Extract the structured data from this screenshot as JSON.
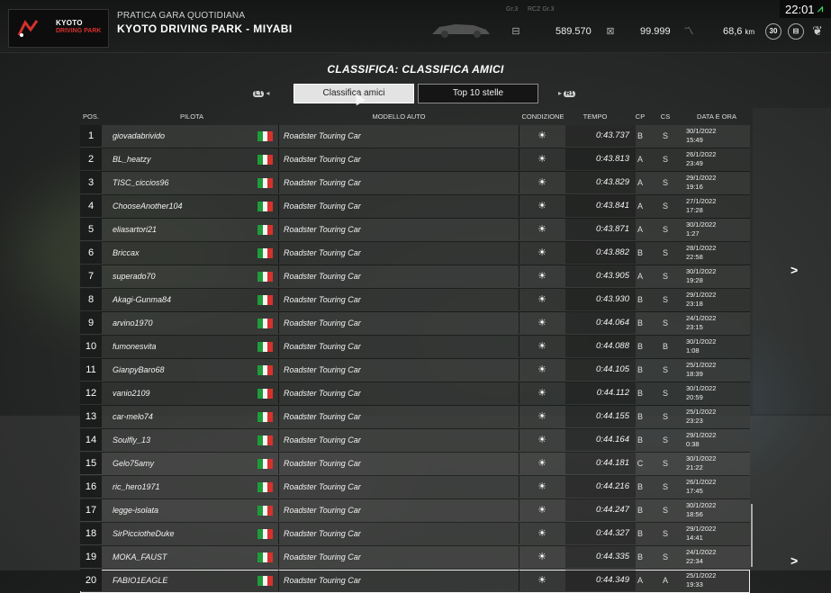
{
  "header": {
    "logo": {
      "line1": "KYOTO",
      "line2": "DRIVING PARK"
    },
    "event_subtitle": "PRATICA GARA QUOTIDIANA",
    "event_title": "KYOTO DRIVING PARK - MIYABI",
    "tags": [
      "Gr.3",
      "RCZ Gr.3"
    ],
    "stats": [
      {
        "icon": "credits-icon",
        "value": "589.570"
      },
      {
        "icon": "mileage-icon",
        "value": "99.999"
      },
      {
        "icon": "distance-icon",
        "value": "68,6",
        "unit": "km"
      }
    ],
    "level_badge": "30",
    "clock": "22:01"
  },
  "page_title": "CLASSIFICA: CLASSIFICA AMICI",
  "tabs": {
    "left_hint": "L1",
    "right_hint": "R1",
    "items": [
      {
        "label": "Classifica amici",
        "active": true
      },
      {
        "label": "Top 10 stelle",
        "active": false
      }
    ]
  },
  "columns": {
    "pos": "POS.",
    "driver": "PILOTA",
    "car": "MODELLO AUTO",
    "condition": "CONDIZIONE",
    "time": "TEMPO",
    "cp": "CP",
    "cs": "CS",
    "date": "DATA E ORA"
  },
  "rows": [
    {
      "pos": "1",
      "name": "giovadabrivido",
      "car": "Roadster Touring Car",
      "time": "0:43.737",
      "cp": "B",
      "cs": "S",
      "date": "30/1/2022",
      "hour": "15:49"
    },
    {
      "pos": "2",
      "name": "BL_heatzy",
      "car": "Roadster Touring Car",
      "time": "0:43.813",
      "cp": "A",
      "cs": "S",
      "date": "26/1/2022",
      "hour": "23:49"
    },
    {
      "pos": "3",
      "name": "TISC_ciccios96",
      "car": "Roadster Touring Car",
      "time": "0:43.829",
      "cp": "A",
      "cs": "S",
      "date": "29/1/2022",
      "hour": "19:16"
    },
    {
      "pos": "4",
      "name": "ChooseAnother104",
      "car": "Roadster Touring Car",
      "time": "0:43.841",
      "cp": "A",
      "cs": "S",
      "date": "27/1/2022",
      "hour": "17:28"
    },
    {
      "pos": "5",
      "name": "eliasartori21",
      "car": "Roadster Touring Car",
      "time": "0:43.871",
      "cp": "A",
      "cs": "S",
      "date": "30/1/2022",
      "hour": "1:27"
    },
    {
      "pos": "6",
      "name": "Briccax",
      "car": "Roadster Touring Car",
      "time": "0:43.882",
      "cp": "B",
      "cs": "S",
      "date": "28/1/2022",
      "hour": "22:58"
    },
    {
      "pos": "7",
      "name": "superado70",
      "car": "Roadster Touring Car",
      "time": "0:43.905",
      "cp": "A",
      "cs": "S",
      "date": "30/1/2022",
      "hour": "19:28"
    },
    {
      "pos": "8",
      "name": "Akagi-Gunma84",
      "car": "Roadster Touring Car",
      "time": "0:43.930",
      "cp": "B",
      "cs": "S",
      "date": "29/1/2022",
      "hour": "23:18"
    },
    {
      "pos": "9",
      "name": "arvino1970",
      "car": "Roadster Touring Car",
      "time": "0:44.064",
      "cp": "B",
      "cs": "S",
      "date": "24/1/2022",
      "hour": "23:15"
    },
    {
      "pos": "10",
      "name": "fumonesvita",
      "car": "Roadster Touring Car",
      "time": "0:44.088",
      "cp": "B",
      "cs": "B",
      "date": "30/1/2022",
      "hour": "1:08"
    },
    {
      "pos": "11",
      "name": "GianpyBaro68",
      "car": "Roadster Touring Car",
      "time": "0:44.105",
      "cp": "B",
      "cs": "S",
      "date": "25/1/2022",
      "hour": "18:39"
    },
    {
      "pos": "12",
      "name": "vanio2109",
      "car": "Roadster Touring Car",
      "time": "0:44.112",
      "cp": "B",
      "cs": "S",
      "date": "30/1/2022",
      "hour": "20:59"
    },
    {
      "pos": "13",
      "name": "car-melo74",
      "car": "Roadster Touring Car",
      "time": "0:44.155",
      "cp": "B",
      "cs": "S",
      "date": "25/1/2022",
      "hour": "23:23"
    },
    {
      "pos": "14",
      "name": "Soulfly_13",
      "car": "Roadster Touring Car",
      "time": "0:44.164",
      "cp": "B",
      "cs": "S",
      "date": "29/1/2022",
      "hour": "0:38"
    },
    {
      "pos": "15",
      "name": "Gelo75amy",
      "car": "Roadster Touring Car",
      "time": "0:44.181",
      "cp": "C",
      "cs": "S",
      "date": "30/1/2022",
      "hour": "21:22"
    },
    {
      "pos": "16",
      "name": "ric_hero1971",
      "car": "Roadster Touring Car",
      "time": "0:44.216",
      "cp": "B",
      "cs": "S",
      "date": "26/1/2022",
      "hour": "17:45"
    },
    {
      "pos": "17",
      "name": "legge-isolata",
      "car": "Roadster Touring Car",
      "time": "0:44.247",
      "cp": "B",
      "cs": "S",
      "date": "30/1/2022",
      "hour": "18:56"
    },
    {
      "pos": "18",
      "name": "SirPicciotheDuke",
      "car": "Roadster Touring Car",
      "time": "0:44.327",
      "cp": "B",
      "cs": "S",
      "date": "29/1/2022",
      "hour": "14:41"
    },
    {
      "pos": "19",
      "name": "MOKA_FAUST",
      "car": "Roadster Touring Car",
      "time": "0:44.335",
      "cp": "B",
      "cs": "S",
      "date": "24/1/2022",
      "hour": "22:34"
    },
    {
      "pos": "20",
      "name": "FABIO1EAGLE",
      "car": "Roadster Touring Car",
      "time": "0:44.349",
      "cp": "A",
      "cs": "A",
      "date": "25/1/2022",
      "hour": "19:33"
    }
  ],
  "flag_colors": [
    "#1f9a3a",
    "#f5f5f5",
    "#d6312c"
  ],
  "condition_icon": "sun-icon"
}
